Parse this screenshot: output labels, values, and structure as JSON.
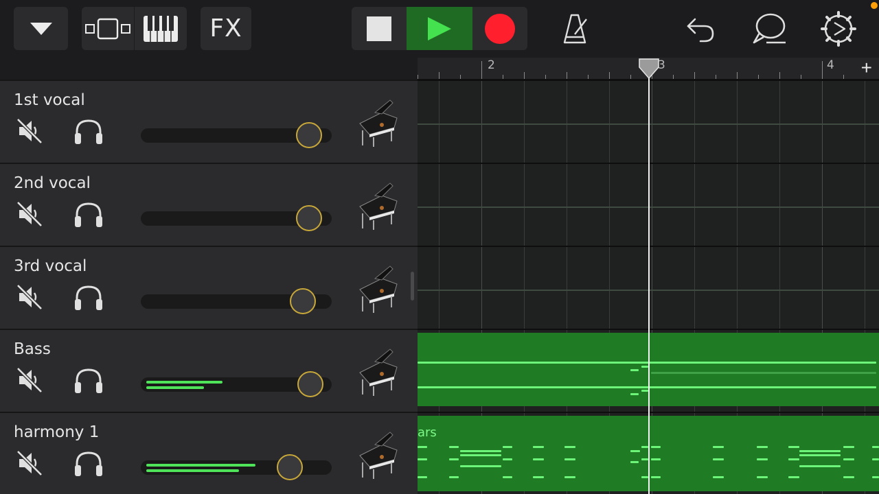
{
  "toolbar": {
    "fx_label": "FX",
    "buttons": [
      "tracks-dropdown-icon",
      "track-view-icon",
      "keyboard-icon",
      "fx",
      "stop-icon",
      "play-icon",
      "record-icon",
      "metronome-icon",
      "undo-icon",
      "loop-browser-icon",
      "settings-icon"
    ]
  },
  "colors": {
    "accent_green": "#1f7c25",
    "note_green": "#6cf579",
    "record_red": "#ff1f2d",
    "knob_gold": "#c9a83a",
    "indicator_orange": "#ff9f0a"
  },
  "ruler": {
    "bars": [
      "2",
      "3",
      "4"
    ],
    "add_label": "+"
  },
  "tracks": [
    {
      "name": "1st vocal",
      "volume": 0.88,
      "meter": [
        0,
        0
      ],
      "instrument": "grand-piano-icon"
    },
    {
      "name": "2nd vocal",
      "volume": 0.88,
      "meter": [
        0,
        0
      ],
      "instrument": "grand-piano-icon"
    },
    {
      "name": "3rd vocal",
      "volume": 0.85,
      "meter": [
        0,
        0
      ],
      "instrument": "grand-piano-icon"
    },
    {
      "name": "Bass",
      "volume": 0.89,
      "meter": [
        0.41,
        0.31
      ],
      "instrument": "grand-piano-icon"
    },
    {
      "name": "harmony 1",
      "volume": 0.78,
      "meter": [
        0.59,
        0.5
      ],
      "instrument": "grand-piano-icon"
    }
  ],
  "regions": {
    "harmony_label": "ars"
  }
}
